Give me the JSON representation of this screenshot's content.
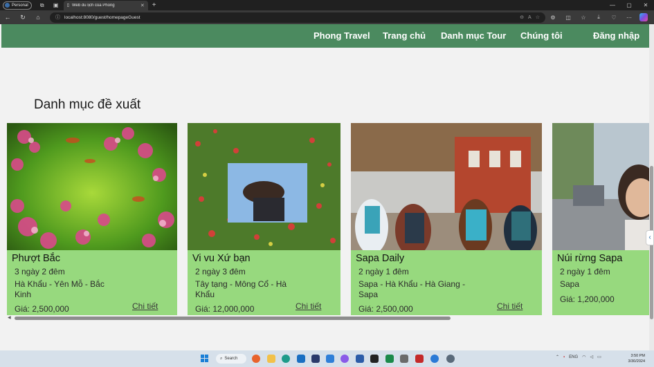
{
  "browser": {
    "profile_label": "Personal",
    "tab_title": "Web du lịch của Phong",
    "url": "localhost:8080/guest/homepageGuest"
  },
  "site": {
    "nav": {
      "brand": "Phong Travel",
      "home": "Trang chủ",
      "tours": "Danh mục Tour",
      "about": "Chúng tôi",
      "login": "Đăng nhập"
    },
    "section_title": "Danh mục đề xuất",
    "tours": [
      {
        "name": "Phượt Bắc",
        "duration": "3 ngày 2 đêm",
        "route": "Hà Khẩu - Yên Mỗ - Bắc Kinh",
        "price": "Giá: 2,500,000",
        "detail": "Chi tiết"
      },
      {
        "name": "Vi vu Xứ bạn",
        "duration": "2 ngày 3 đêm",
        "route": "Tây tạng - Mông Cổ - Hà Khẩu",
        "price": "Giá: 12,000,000",
        "detail": "Chi tiết"
      },
      {
        "name": "Sapa Daily",
        "duration": "2 ngày 1 đêm",
        "route": "Sapa - Hà Khẩu - Hà Giang - Sapa",
        "price": "Giá: 2,500,000",
        "detail": "Chi tiết"
      },
      {
        "name": "Núi rừng Sapa",
        "duration": "2 ngày 1 đêm",
        "route": "Sapa",
        "price": "Giá: 1,200,000",
        "detail": ""
      }
    ]
  },
  "taskbar": {
    "search_label": "Search",
    "lang": "ENG",
    "time": "3:50 PM",
    "date": "3/30/2024"
  }
}
